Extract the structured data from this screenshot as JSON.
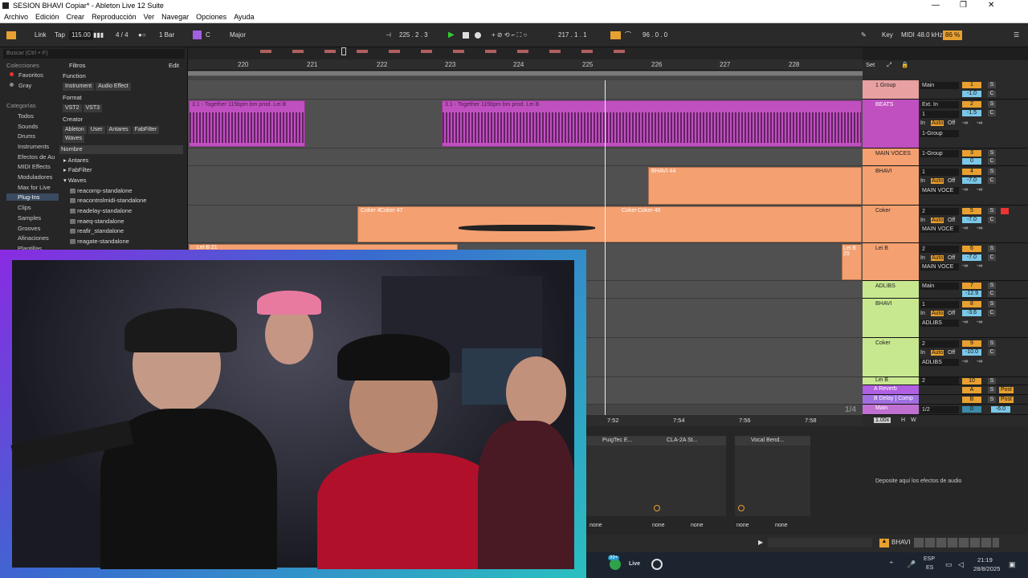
{
  "window": {
    "title": "SESION BHAVI Copiar* - Ableton Live 12 Suite",
    "min": "—",
    "max": "❐",
    "close": "✕"
  },
  "menu": [
    "Archivo",
    "Edición",
    "Crear",
    "Reproducción",
    "Ver",
    "Navegar",
    "Opciones",
    "Ayuda"
  ],
  "transport": {
    "link": "Link",
    "tap": "Tap",
    "tempo": "115.00",
    "sig": "4 / 4",
    "quant": "1 Bar",
    "key": "C",
    "scale": "Major",
    "pos": "225 .  2 .  3",
    "loop_start": "217 .  1 .  1",
    "loop_len": "96 .  0 .  0",
    "key_label": "Key",
    "midi": "MIDI",
    "sr": "48.0 kHz",
    "cpu": "86 %"
  },
  "browser": {
    "search": "Buscar (Ctrl + F)",
    "col_head": "Colecciones",
    "collections": [
      "Favoritos",
      "Gray"
    ],
    "cat_head": "Categorías",
    "categories": [
      "Todos",
      "Sounds",
      "Drums",
      "Instruments",
      "Efectos de Au",
      "MIDI Effects",
      "Moduladores",
      "Max for Live",
      "Plug-Ins",
      "Clips",
      "Samples",
      "Grooves",
      "Afinaciones",
      "Plantillas"
    ],
    "filters": "Filtros",
    "edit": "Edit",
    "function": "Function",
    "function_tags": [
      "Instrument",
      "Audio Effect"
    ],
    "format": "Format",
    "format_tags": [
      "VST2",
      "VST3"
    ],
    "creator": "Creator",
    "creator_tags": [
      "Ableton",
      "User",
      "Antares",
      "FabFilter",
      "Waves"
    ],
    "name_col": "Nombre",
    "folders": [
      "Antares",
      "FabFilter",
      "Waves"
    ],
    "plugins": [
      "reacomp-standalone",
      "reacontrolmidi-standalone",
      "readelay-standalone",
      "reaeq-standalone",
      "reafir_standalone",
      "reagate-standalone"
    ]
  },
  "ruler": [
    "220",
    "221",
    "222",
    "223",
    "224",
    "225",
    "226",
    "227",
    "228"
  ],
  "clips": {
    "c1": "3.1 - Together 115bpm bm prod. Lei B",
    "c2": "3.1 - Together 115bpm bm prod. Lei B",
    "bhavi": "BHAVI 44",
    "coker1": "Coker 4",
    "coker2": "Coker 47",
    "coker3": "Coker",
    "coker4": "Coker 40",
    "leib1": "Lei B 21",
    "leib2": "Lei B 29"
  },
  "mixer": {
    "set": "Set",
    "tracks": [
      {
        "name": "1 Group",
        "io": "Main",
        "num": "1",
        "vol": "-1.0",
        "color": "#e8a0a0"
      },
      {
        "name": "BEATS",
        "io": "Ext. In",
        "sub": "1",
        "in2": "1-Group",
        "num": "2",
        "vol": "-1.5",
        "color": "#c050c0"
      },
      {
        "name": "MAIN VOCES",
        "io": "1-Group",
        "num": "3",
        "vol": "0",
        "color": "#f5a070"
      },
      {
        "name": "BHAVI",
        "io": "1",
        "sub": "MAIN VOCE",
        "num": "4",
        "vol": "-7.0",
        "color": "#f5a070"
      },
      {
        "name": "Coker",
        "io": "2",
        "sub": "MAIN VOCE",
        "num": "5",
        "vol": "-7.0",
        "color": "#f5a070"
      },
      {
        "name": "Lei B",
        "io": "2",
        "sub": "MAIN VOCE",
        "num": "6",
        "vol": "-7.0",
        "color": "#f5a070"
      },
      {
        "name": "ADLIBS",
        "io": "Main",
        "num": "7",
        "vol": "-12.9",
        "color": "#c8e890"
      },
      {
        "name": "BHAVI",
        "io": "1",
        "sub": "ADLIBS",
        "num": "8",
        "vol": "-3.6",
        "color": "#c8e890"
      },
      {
        "name": "Coker",
        "io": "2",
        "sub": "ADLIBS",
        "num": "9",
        "vol": "-10.0",
        "color": "#c8e890"
      },
      {
        "name": "Lei B",
        "io": "2",
        "num": "10",
        "vol": "",
        "color": "#c8e890"
      }
    ],
    "returns": [
      {
        "name": "A Reverb",
        "btn": "A",
        "post": "Post"
      },
      {
        "name": "B Delay | Comp",
        "btn": "B",
        "post": "Post"
      }
    ],
    "main": {
      "name": "Main",
      "io": "1/2",
      "num": "0",
      "vol": "-6.0"
    },
    "ratio": "1/4",
    "zoom": "1.00x"
  },
  "timeline2": [
    "7:52",
    "7:54",
    "7:56",
    "7:58"
  ],
  "auto_in": "In",
  "auto": "Auto",
  "off": "Off",
  "inf": "-∞",
  "c_btn": "C",
  "s_btn": "S",
  "devices": {
    "d1": "PuigTec E...",
    "d2": "CLA-2A St...",
    "d3": "Vocal Bend...",
    "drop": "Deposite aquí los efectos de audio",
    "none": "none"
  },
  "status": {
    "track": "BHAVI"
  },
  "taskbar": {
    "badge": "99+",
    "live": "Live",
    "lang1": "ESP",
    "lang2": "ES",
    "time": "21:19",
    "date": "28/8/2025"
  }
}
